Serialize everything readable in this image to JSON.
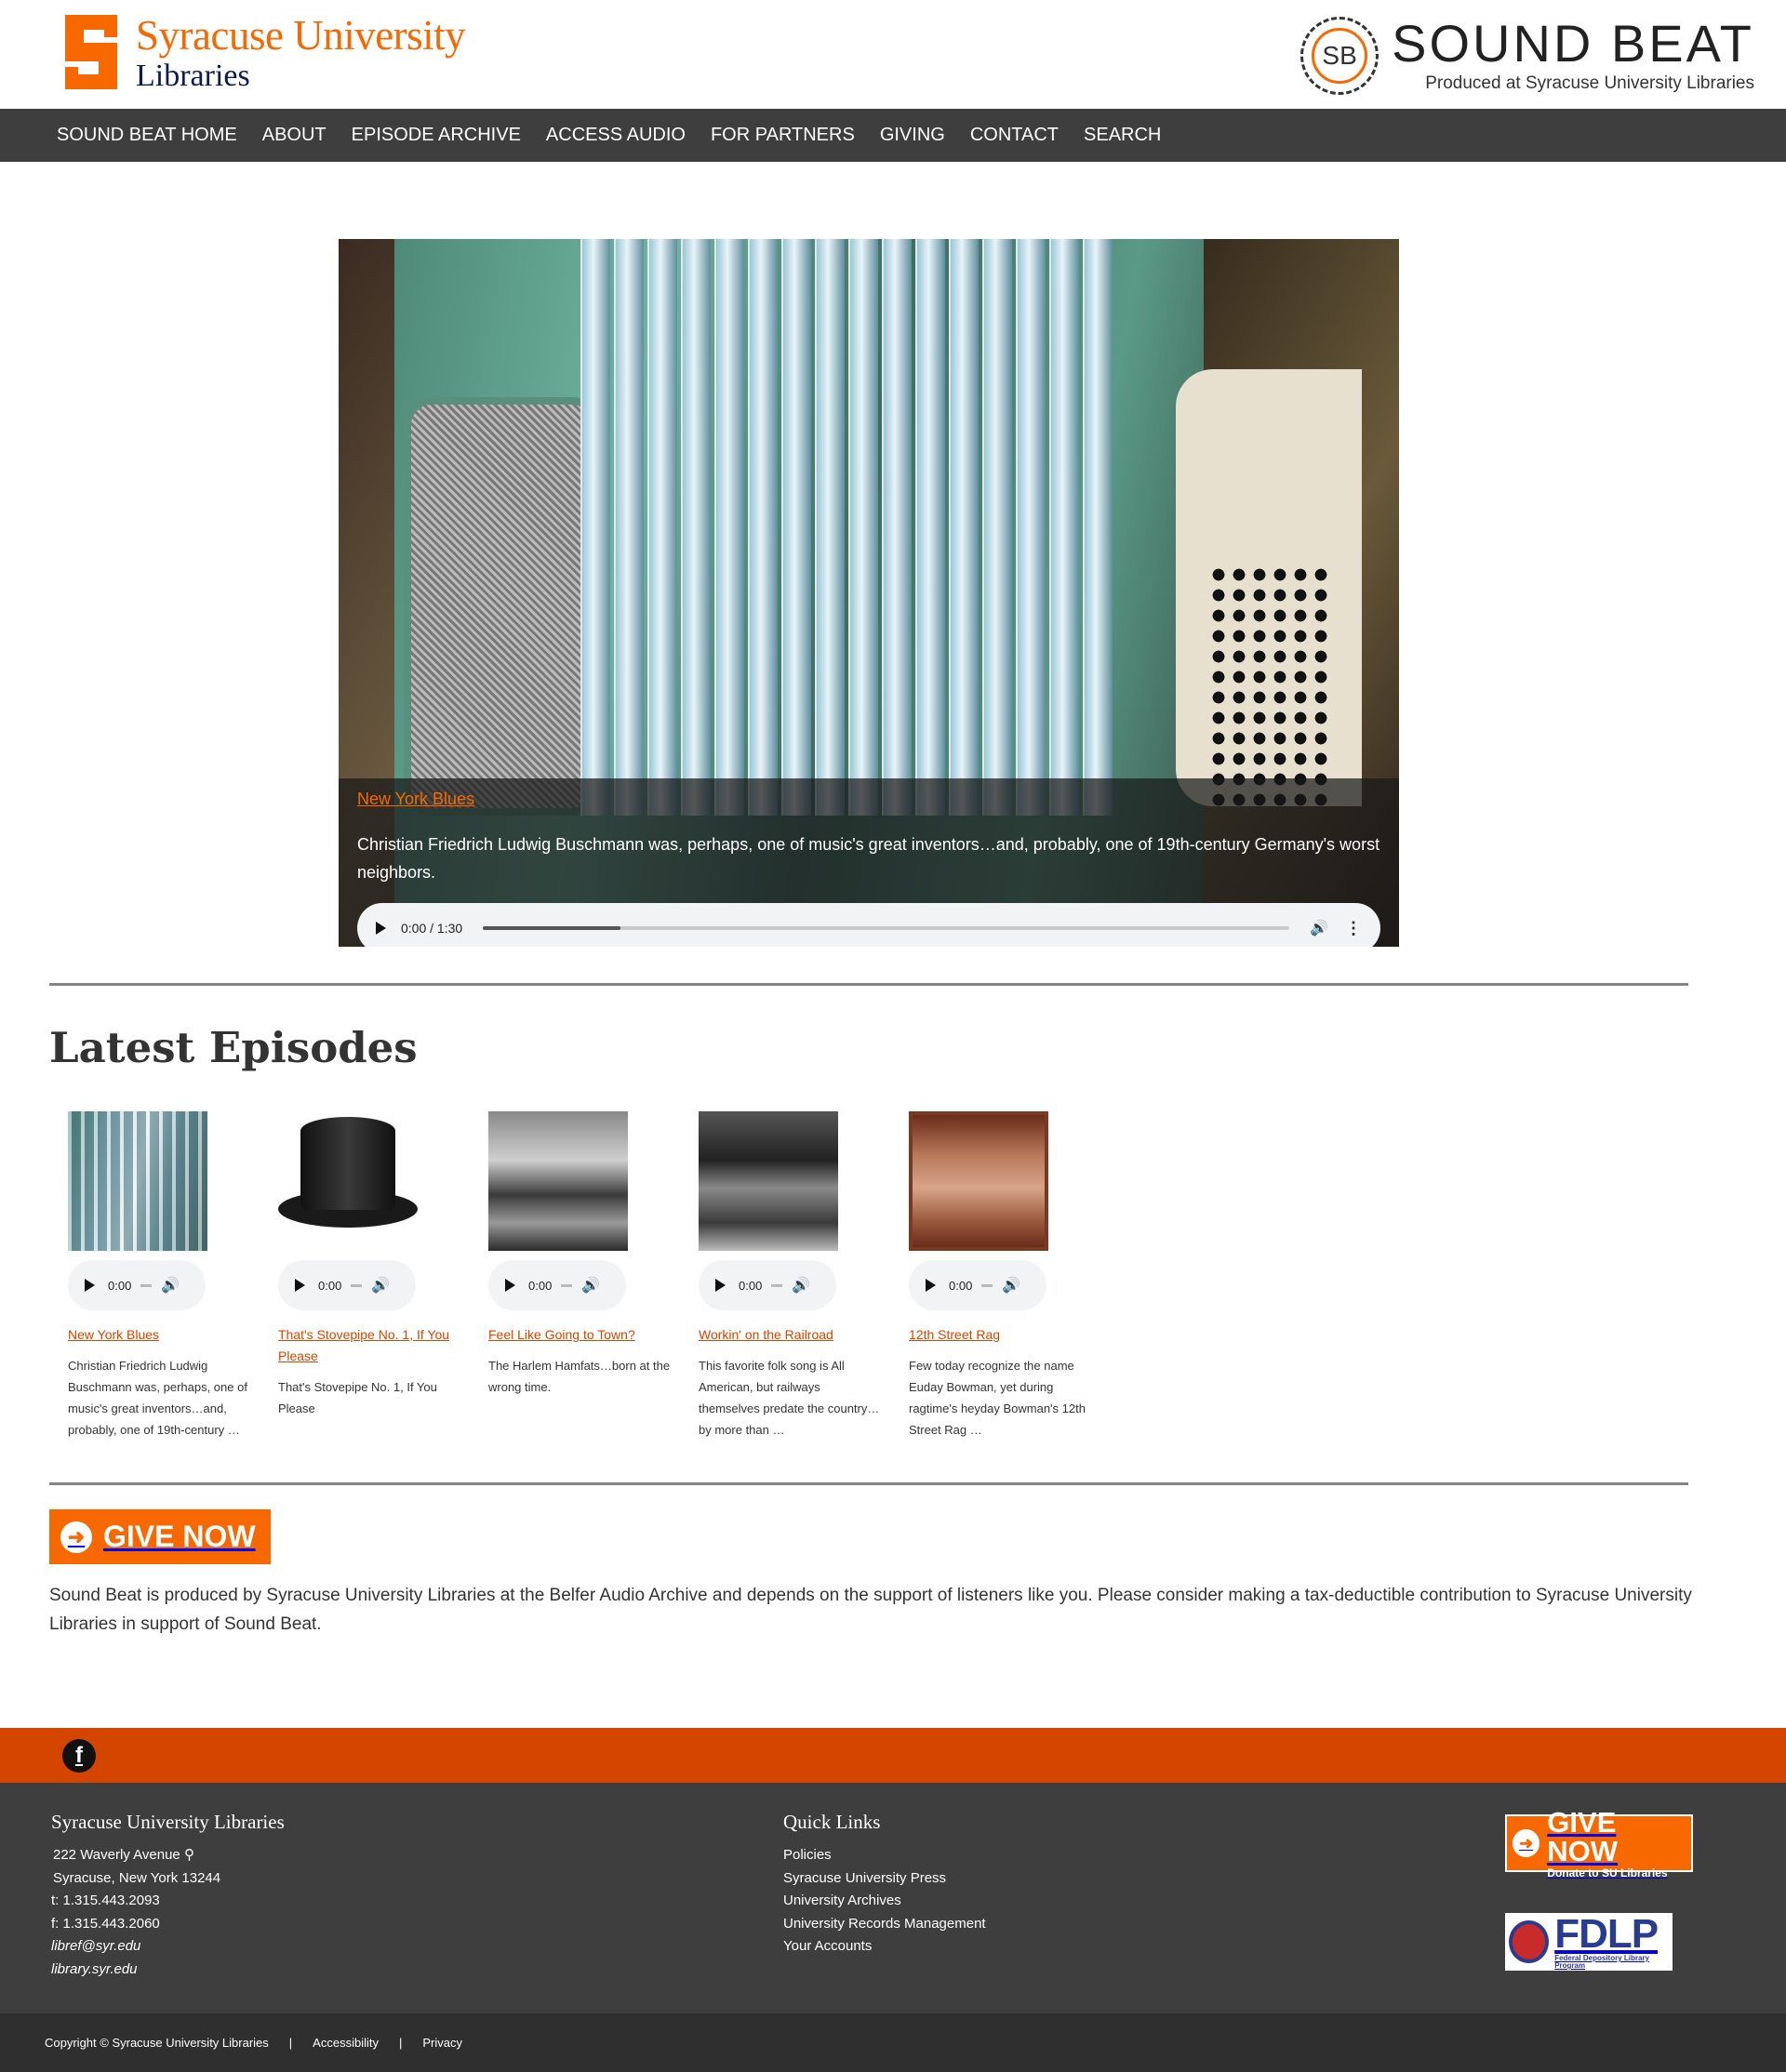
{
  "header": {
    "university_name": "Syracuse University",
    "libraries_name": "Libraries",
    "sb_initials": "SB",
    "sb_title": "SOUND BEAT",
    "sb_subtitle": "Produced at Syracuse University Libraries",
    "brand_orange": "#f76900",
    "brand_navy": "#0d1c4b"
  },
  "nav": {
    "items": [
      "SOUND BEAT HOME",
      "ABOUT",
      "EPISODE ARCHIVE",
      "ACCESS AUDIO",
      "FOR PARTNERS",
      "GIVING",
      "CONTACT",
      "SEARCH"
    ]
  },
  "hero": {
    "episode_link": "New York Blues",
    "description": "Christian Friedrich Ludwig Buschmann was, perhaps, one of music's great inventors…and, probably, one of 19th-century Germany's worst neighbors.",
    "player_time": "0:00 / 1:30",
    "progress_fraction": 0.17
  },
  "latest": {
    "title": "Latest Episodes",
    "episodes": [
      {
        "title": "New York Blues",
        "time": "0:00",
        "desc": "Christian Friedrich Ludwig Buschmann was, perhaps, one of music's great inventors…and, probably, one of 19th-century …"
      },
      {
        "title": "That's Stovepipe No. 1, If You Please",
        "time": "0:00",
        "desc": "That's Stovepipe No. 1, If You Please"
      },
      {
        "title": "Feel Like Going to Town?",
        "time": "0:00",
        "desc": "The Harlem Hamfats…born at the wrong time."
      },
      {
        "title": "Workin' on the Railroad",
        "time": "0:00",
        "desc": "This favorite folk song is All American, but railways themselves predate the country…by more than …"
      },
      {
        "title": "12th Street Rag",
        "time": "0:00",
        "desc": "Few today recognize the name Euday Bowman, yet during ragtime's heyday Bowman's 12th Street Rag …"
      }
    ]
  },
  "give": {
    "button_label": "GIVE NOW",
    "support_text": "Sound Beat is produced by Syracuse University Libraries at the Belfer Audio Archive and depends on the support of listeners like you. Please consider making a tax-deductible contribution to Syracuse University Libraries in support of Sound Beat."
  },
  "footer": {
    "facebook_icon": "facebook-icon",
    "org_title": "Syracuse University Libraries",
    "address_line1": "222 Waverly Avenue",
    "address_line2": "Syracuse, New York 13244",
    "phone": "t: 1.315.443.2093",
    "fax": "f: 1.315.443.2060",
    "email": "libref@syr.edu",
    "website": "library.syr.edu",
    "quick_links_title": "Quick Links",
    "quick_links": [
      "Policies",
      "Syracuse University Press",
      "University Archives",
      "University Records Management",
      "Your Accounts"
    ],
    "give_big": "GIVE NOW",
    "give_small": "Donate to SU Libraries",
    "fdlp_big": "FDLP",
    "fdlp_small": "Federal Depository Library Program",
    "footer_orange": "#d44500"
  },
  "copyright": {
    "text": "Copyright © Syracuse University Libraries",
    "sep": "|",
    "accessibility": "Accessibility",
    "privacy": "Privacy"
  }
}
